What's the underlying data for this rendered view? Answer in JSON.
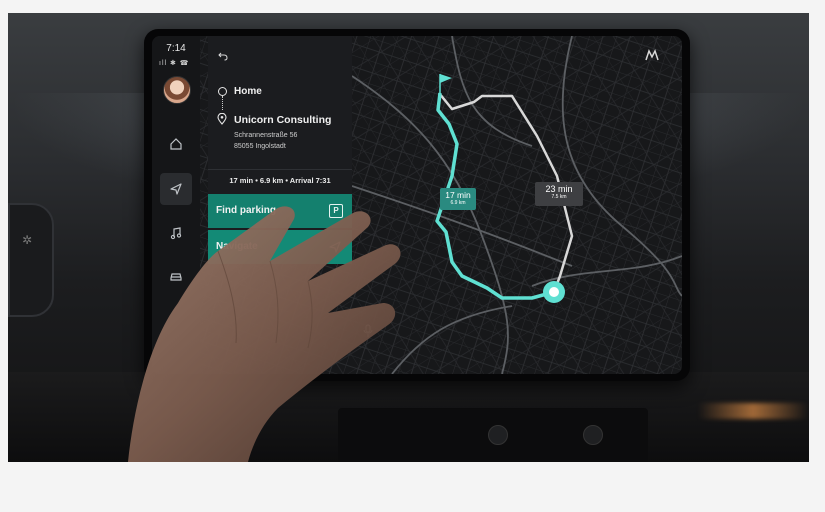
{
  "statusbar": {
    "time": "7:14",
    "icons_text": "ıll ✱ ☎"
  },
  "rail": {
    "items": [
      {
        "name": "home",
        "icon": "home-icon",
        "active": false
      },
      {
        "name": "navigation",
        "icon": "navigation-arrow-icon",
        "active": true
      },
      {
        "name": "media",
        "icon": "music-note-icon",
        "active": false
      },
      {
        "name": "vehicle",
        "icon": "car-icon",
        "active": false
      }
    ]
  },
  "panel": {
    "origin": "Home",
    "destination": {
      "name": "Unicorn Consulting",
      "street": "Schrannenstraße 56",
      "city": "85055 Ingolstadt"
    },
    "trip_summary": "17 min • 6.9 km • Arrival 7:31",
    "find_parking_label": "Find parking",
    "parking_icon_text": "P",
    "navigate_label": "Navigate"
  },
  "map": {
    "primary_route": {
      "time": "17 min",
      "distance": "6.9 km",
      "color": "#5fe0d2"
    },
    "alternative_route": {
      "time": "23 min",
      "distance": "7.5 km",
      "color": "#d8d8d8"
    },
    "accent": "#14806e"
  }
}
